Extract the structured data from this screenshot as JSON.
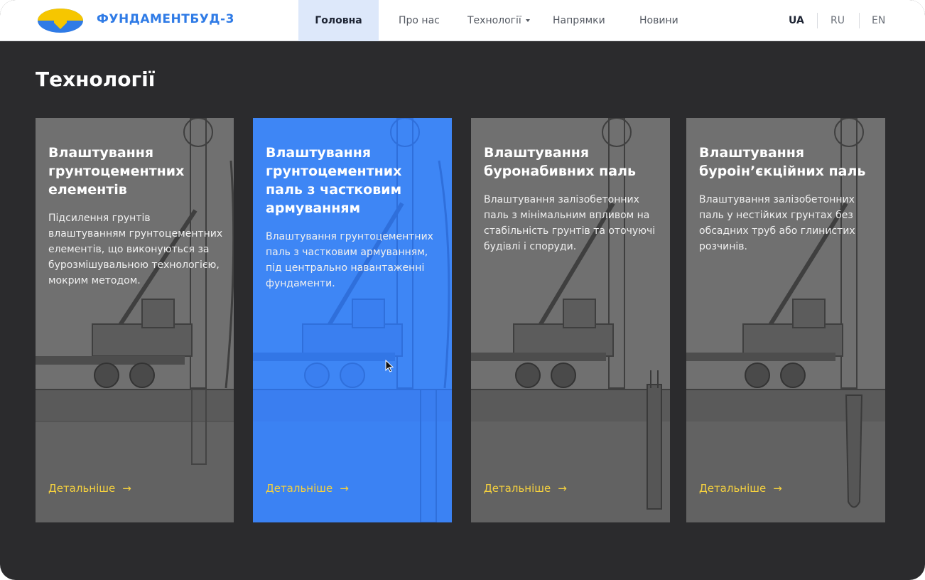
{
  "header": {
    "brand": "ФУНДАМЕНТБУД-3",
    "nav": [
      {
        "label": "Головна",
        "active": true
      },
      {
        "label": "Про нас",
        "active": false
      },
      {
        "label": "Технології",
        "active": false,
        "has_dropdown": true
      },
      {
        "label": "Напрямки",
        "active": false
      },
      {
        "label": "Новини",
        "active": false
      }
    ],
    "languages": [
      {
        "code": "UA",
        "active": true
      },
      {
        "code": "RU",
        "active": false
      },
      {
        "code": "EN",
        "active": false
      }
    ]
  },
  "section": {
    "title": "Технології",
    "cards": [
      {
        "title": "Влаштування грунтоцементних елементів",
        "description": "Підсилення грунтів влаштуванням грунтоцементних елементів, що виконуються за бурозмішувальною технологією, мокрим методом.",
        "link": "Детальніше",
        "highlighted": false
      },
      {
        "title": "Влаштування грунтоцементних паль з частковим армуванням",
        "description": "Влаштування грунтоцементних паль з частковим армуванням, під центрально навантаженні фундаменти.",
        "link": "Детальніше",
        "highlighted": true
      },
      {
        "title": "Влаштування буронабивних паль",
        "description": "Влаштування залізобетонних паль з мінімальним впливом на стабільність грунтів та оточуючі будівлі і споруди.",
        "link": "Детальніше",
        "highlighted": false
      },
      {
        "title": "Влаштування буроін’єкційних паль",
        "description": "Влаштування залізобетонних паль у нестійких грунтах без обсадних труб або глинистих розчинів.",
        "link": "Детальніше",
        "highlighted": false
      }
    ]
  },
  "colors": {
    "accent": "#2f7be6",
    "highlight_card": "#3e86f5",
    "link": "#f4d03f",
    "background": "#2b2b2d",
    "card": "#707070"
  },
  "icons": {
    "arrow": "arrow-right-icon",
    "caret": "chevron-down-icon",
    "logo": "foundation-logo"
  }
}
